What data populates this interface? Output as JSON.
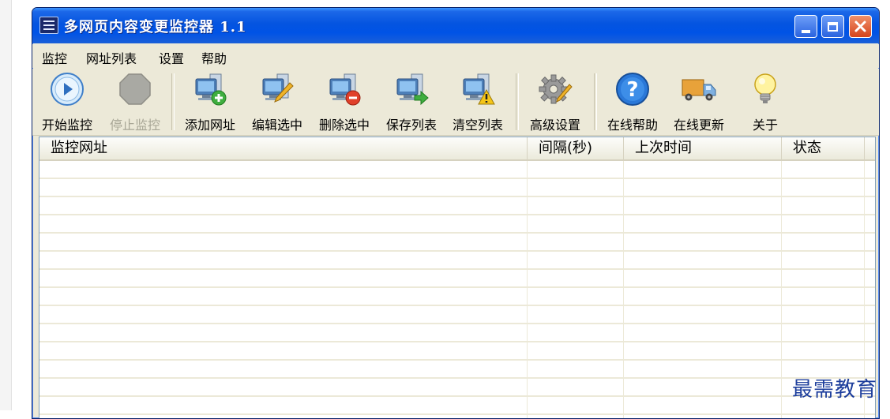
{
  "window": {
    "title": "多网页内容变更监控器 1.1"
  },
  "menu": [
    "监控",
    "网址列表",
    "设置",
    "帮助"
  ],
  "toolbar": {
    "start": "开始监控",
    "stop": "停止监控",
    "add": "添加网址",
    "edit": "编辑选中",
    "delete": "删除选中",
    "save": "保存列表",
    "clear": "清空列表",
    "advanced": "高级设置",
    "help": "在线帮助",
    "update": "在线更新",
    "about": "关于"
  },
  "list": {
    "columns": [
      "监控网址",
      "间隔(秒)",
      "上次时间",
      "状态"
    ],
    "rows": []
  },
  "watermark": "最需教育",
  "icons": {
    "start": "play-icon",
    "stop": "stop-icon",
    "add": "computer-add-icon",
    "edit": "computer-edit-icon",
    "delete": "computer-delete-icon",
    "save": "computer-save-icon",
    "clear": "computer-warning-icon",
    "advanced": "gear-icon",
    "help": "question-icon",
    "update": "truck-icon",
    "about": "lightbulb-icon"
  },
  "colors": {
    "titlebar": "#0454e0",
    "window_bg": "#ece9d8",
    "close_button": "#d6441c",
    "disabled_text": "#a8a696"
  }
}
